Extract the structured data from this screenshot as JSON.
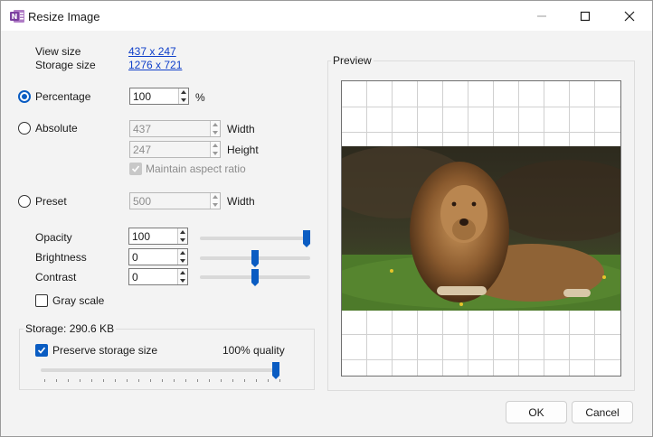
{
  "window": {
    "title": "Resize Image"
  },
  "info": {
    "view_size_label": "View size",
    "view_size_value": "437 x 247",
    "storage_size_label": "Storage size",
    "storage_size_value": "1276 x 721"
  },
  "percentage": {
    "label": "Percentage",
    "value": "100",
    "unit": "%",
    "selected": true
  },
  "absolute": {
    "label": "Absolute",
    "width_value": "437",
    "width_label": "Width",
    "height_value": "247",
    "height_label": "Height",
    "aspect_label": "Maintain aspect ratio"
  },
  "preset": {
    "label": "Preset",
    "value": "500",
    "width_label": "Width"
  },
  "adjust": {
    "opacity_label": "Opacity",
    "opacity_value": "100",
    "opacity_level": 1.0,
    "brightness_label": "Brightness",
    "brightness_value": "0",
    "brightness_level": 0.5,
    "contrast_label": "Contrast",
    "contrast_value": "0",
    "contrast_level": 0.5,
    "grayscale_label": "Gray scale"
  },
  "storage": {
    "title": "Storage: 290.6 KB",
    "preserve_label": "Preserve storage size",
    "quality_label": "100% quality",
    "quality_level": 1.0
  },
  "preview": {
    "title": "Preview"
  },
  "buttons": {
    "ok": "OK",
    "cancel": "Cancel"
  },
  "colors": {
    "accent": "#0a5cc2",
    "link": "#0f3fc9",
    "app_icon": "#7b3fa0"
  }
}
